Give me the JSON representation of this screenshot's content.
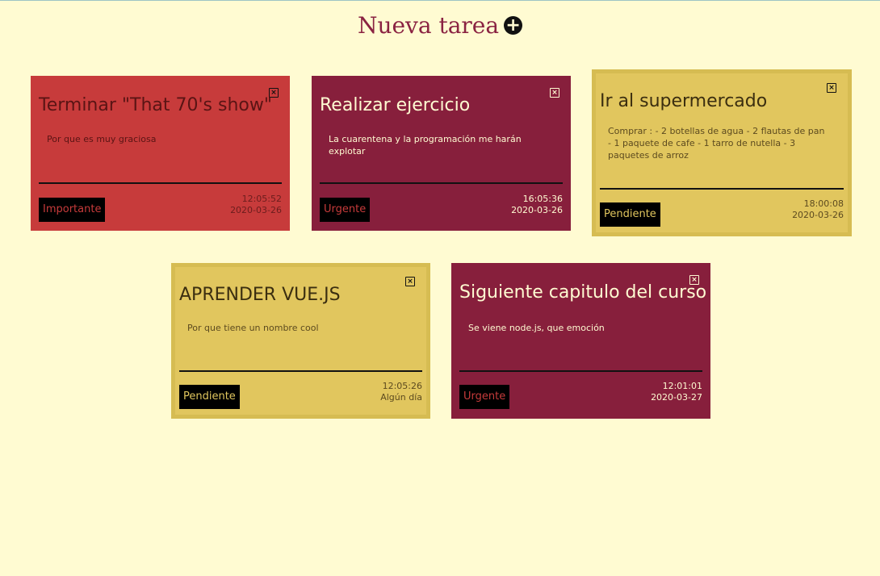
{
  "header": {
    "title": "Nueva tarea",
    "add_icon": "plus-circle-icon"
  },
  "tasks": [
    {
      "title": "Terminar \"That 70's show\"",
      "description": "Por que es muy graciosa",
      "priority": "Importante",
      "time": "12:05:52",
      "date": "2020-03-26",
      "color": "#c73b3b"
    },
    {
      "title": "Realizar ejercicio",
      "description": "La cuarentena y la programación me harán explotar",
      "priority": "Urgente",
      "time": "16:05:36",
      "date": "2020-03-26",
      "color": "#871f3c"
    },
    {
      "title": "Ir al supermercado",
      "description": "Comprar : - 2 botellas de agua - 2 flautas de pan - 1 paquete de cafe - 1 tarro de nutella - 3 paquetes de arroz",
      "priority": "Pendiente",
      "time": "18:00:08",
      "date": "2020-03-26",
      "color": "#e1c65e"
    },
    {
      "title": "APRENDER VUE.JS",
      "description": "Por que tiene un nombre cool",
      "priority": "Pendiente",
      "time": "12:05:26",
      "date": "Algún día",
      "color": "#e1c65e"
    },
    {
      "title": "Siguiente capitulo del curso",
      "description": "Se viene node.js, que emoción",
      "priority": "Urgente",
      "time": "12:01:01",
      "date": "2020-03-27",
      "color": "#871f3c"
    }
  ],
  "close_icon": "close-icon",
  "close_glyph": "×"
}
